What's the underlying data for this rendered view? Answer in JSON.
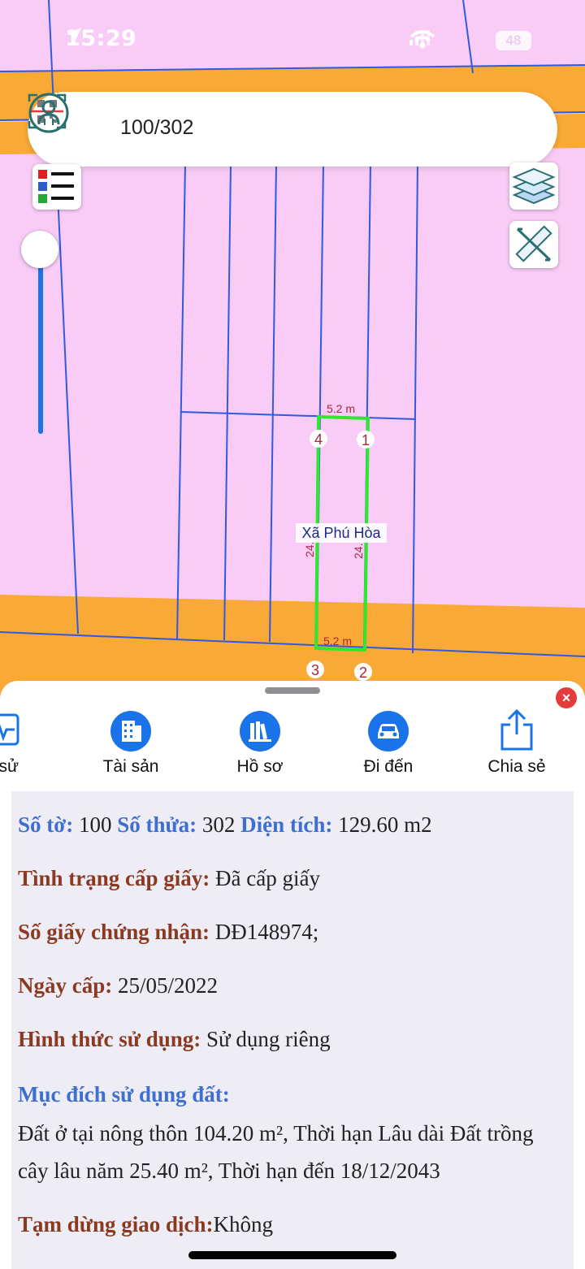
{
  "status_bar": {
    "time": "15:29",
    "battery": "48"
  },
  "search": {
    "query": "100/302",
    "icons": [
      "qr-scan-icon",
      "user-icon"
    ]
  },
  "map": {
    "map_buttons": [
      "legend-icon",
      "layers-icon",
      "ruler-icon"
    ],
    "parcel": {
      "top_edge": "5.2 m",
      "bottom_edge": "5.2 m",
      "left_edge": "24.",
      "right_edge": "24.",
      "vertices": [
        "1",
        "2",
        "3",
        "4"
      ],
      "commune": "Xã Phú Hòa"
    },
    "colors": {
      "residential": "#f8ccf7",
      "road": "#f9a936",
      "parcel_outline": "#2ee82e",
      "boundary": "#2f5be0"
    }
  },
  "actions": [
    {
      "label": "h sử",
      "icon": "history-chart-icon"
    },
    {
      "label": "Tài sản",
      "icon": "building-icon"
    },
    {
      "label": "Hồ sơ",
      "icon": "books-icon"
    },
    {
      "label": "Đi đến",
      "icon": "car-icon"
    },
    {
      "label": "Chia sẻ",
      "icon": "share-icon"
    }
  ],
  "info": {
    "so_to_label": "Số tờ:",
    "so_to_value": "100",
    "so_thua_label": "Số thửa:",
    "so_thua_value": "302",
    "dien_tich_label": "Diện tích:",
    "dien_tich_value": "129.60 m2",
    "tinh_trang_label": "Tình trạng cấp giấy:",
    "tinh_trang_value": "Đã cấp giấy",
    "so_giay_label": "Số giấy chứng nhận:",
    "so_giay_value": "DĐ148974;",
    "ngay_cap_label": "Ngày cấp:",
    "ngay_cap_value": "25/05/2022",
    "hinh_thuc_label": "Hình thức sử dụng:",
    "hinh_thuc_value": "Sử dụng riêng",
    "muc_dich_label": "Mục đích sử dụng đất:",
    "muc_dich_value": "Đất ở tại nông thôn 104.20 m², Thời hạn Lâu dài Đất trồng cây lâu năm 25.40 m², Thời hạn đến 18/12/2043",
    "tam_dung_label": "Tạm dừng giao dịch:",
    "tam_dung_value": "Không"
  }
}
